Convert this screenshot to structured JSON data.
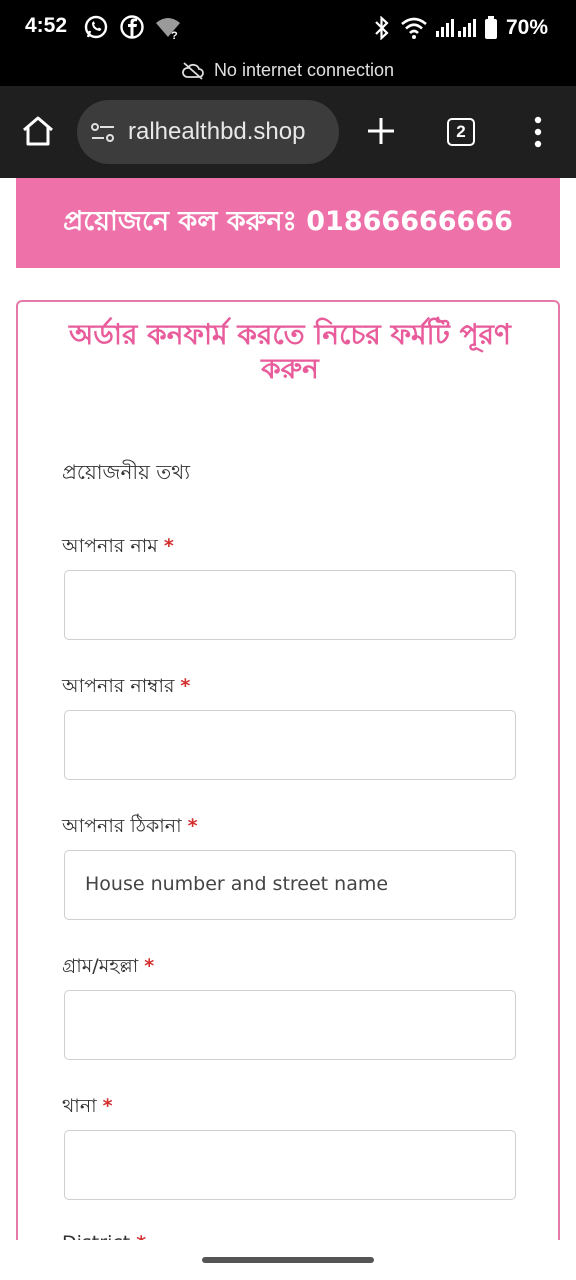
{
  "status_bar": {
    "time": "4:52",
    "battery_percent": "70%",
    "icons": [
      "whatsapp-icon",
      "facebook-icon",
      "wifi-question-icon",
      "bluetooth-icon",
      "wifi-icon",
      "signal-icon",
      "battery-icon"
    ]
  },
  "network_banner": {
    "text": "No internet connection",
    "icon": "cloud-off-icon"
  },
  "browser": {
    "url": "ralhealthbd.shop",
    "tab_count": "2",
    "icons": [
      "home-icon",
      "site-settings-icon",
      "new-tab-icon",
      "tabs-icon",
      "menu-icon"
    ]
  },
  "page": {
    "call_banner": "প্রয়োজনে কল করুনঃ 01866666666",
    "form_title": "অর্ডার কনফার্ম করতে নিচের ফর্মটি পূরণ করুন",
    "section_title": "প্রয়োজনীয় তথ্য",
    "required_mark": "*",
    "fields": [
      {
        "label": "আপনার নাম",
        "placeholder": ""
      },
      {
        "label": "আপনার নাম্বার",
        "placeholder": ""
      },
      {
        "label": "আপনার ঠিকানা",
        "placeholder": "House number and street name"
      },
      {
        "label": "গ্রাম/মহল্লা",
        "placeholder": ""
      },
      {
        "label": "থানা",
        "placeholder": ""
      },
      {
        "label": "District",
        "placeholder": ""
      }
    ]
  },
  "colors": {
    "accent_pink": "#ee72a9",
    "title_pink": "#e85c9b",
    "required_red": "#d32f2f"
  }
}
